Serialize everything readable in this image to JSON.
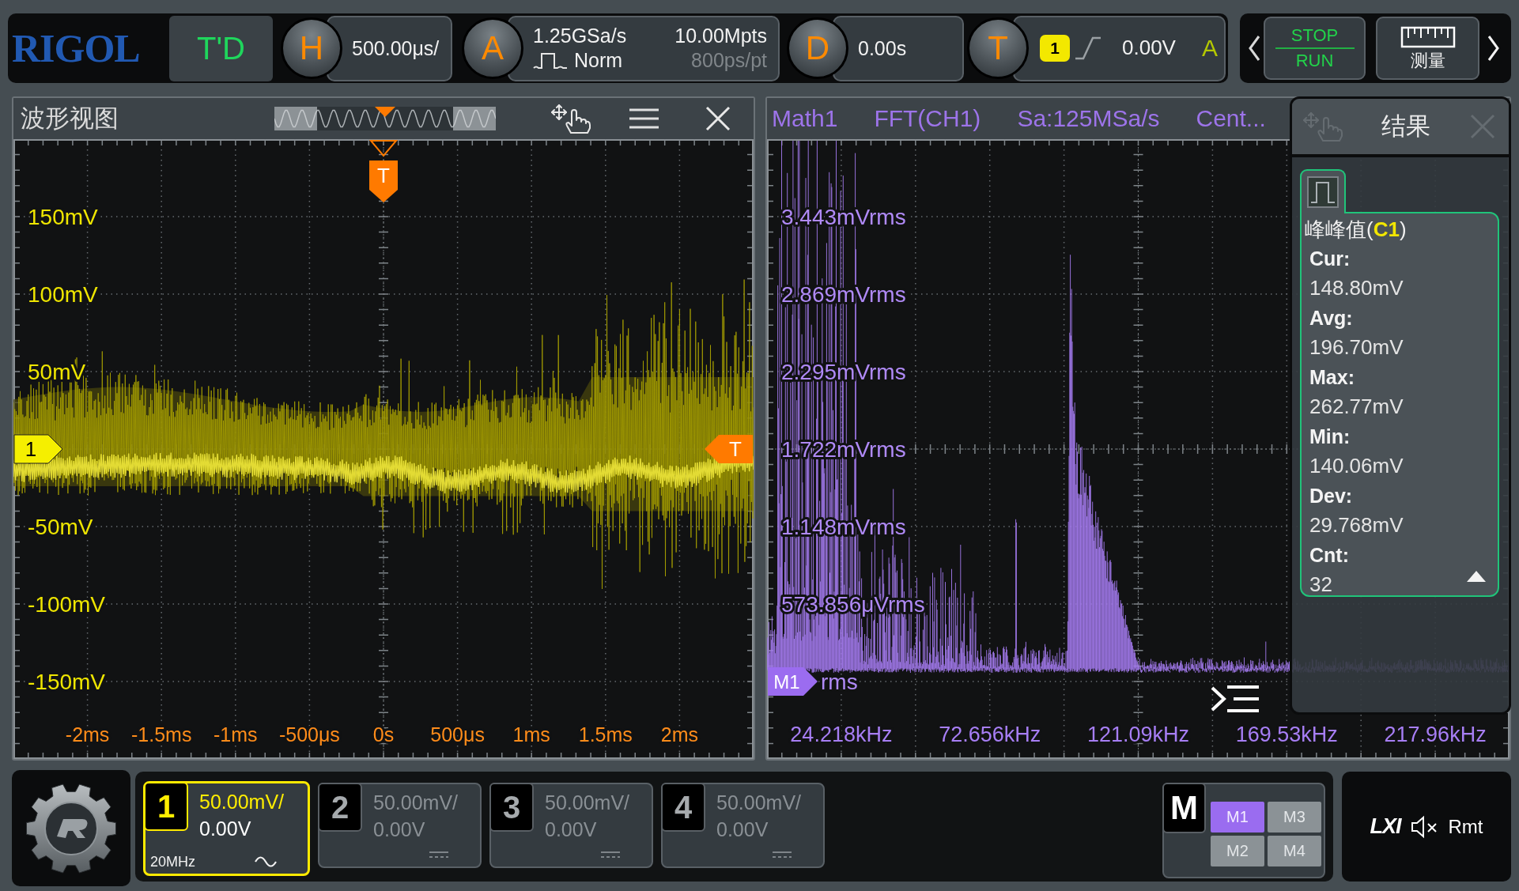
{
  "top_bar": {
    "logo": "RIGOL",
    "td_button": "T'D",
    "horizontal": {
      "badge": "H",
      "scale": "500.00μs/"
    },
    "acquisition": {
      "badge": "A",
      "sample_rate": "1.25GSa/s",
      "memory_depth": "10.00Mpts",
      "mode": "Norm",
      "time_per_point": "800ps/pt"
    },
    "delay": {
      "badge": "D",
      "offset": "0.00s"
    },
    "trigger": {
      "badge": "T",
      "source": "1",
      "level": "0.00V",
      "sweep": "A"
    },
    "run_stop": {
      "top": "STOP",
      "bottom": "RUN"
    },
    "measure_button": "测量"
  },
  "waveform_view": {
    "title": "波形视图",
    "y_labels": [
      "150mV",
      "100mV",
      "50mV",
      "-50mV",
      "-100mV",
      "-150mV"
    ],
    "x_labels": [
      "-2ms",
      "-1.5ms",
      "-1ms",
      "-500μs",
      "0s",
      "500μs",
      "1ms",
      "1.5ms",
      "2ms"
    ],
    "trigger_position_marker": "T",
    "channel_marker": "1",
    "trigger_level_marker": "T"
  },
  "fft_view": {
    "header": [
      "Math1",
      "FFT(CH1)",
      "Sa:125MSa/s",
      "Cent..."
    ],
    "y_labels": [
      "3.443mVrms",
      "2.869mVrms",
      "2.295mVrms",
      "1.722mVrms",
      "1.148mVrms",
      "573.856μVrms",
      "rms"
    ],
    "x_labels": [
      "24.218kHz",
      "72.656kHz",
      "121.09kHz",
      "169.53kHz",
      "217.96kHz"
    ],
    "math_marker": "M1"
  },
  "results": {
    "title": "结果",
    "measurement": {
      "title_parts": [
        {
          "text": "峰峰值(",
          "kind": "plain"
        },
        {
          "text": "C1",
          "kind": "source"
        },
        {
          "text": ")",
          "kind": "plain"
        }
      ],
      "rows": [
        {
          "label": "Cur:",
          "value": "148.80mV"
        },
        {
          "label": "Avg:",
          "value": "196.70mV"
        },
        {
          "label": "Max:",
          "value": "262.77mV"
        },
        {
          "label": "Min:",
          "value": "140.06mV"
        },
        {
          "label": "Dev:",
          "value": "29.768mV"
        },
        {
          "label": "Cnt:",
          "value": "32"
        }
      ]
    }
  },
  "channels": [
    {
      "number": "1",
      "scale": "50.00mV/",
      "offset": "0.00V",
      "bandwidth": "20MHz",
      "ac_coupled": true,
      "on": true
    },
    {
      "number": "2",
      "scale": "50.00mV/",
      "offset": "0.00V",
      "ac_coupled": false,
      "on": false
    },
    {
      "number": "3",
      "scale": "50.00mV/",
      "offset": "0.00V",
      "ac_coupled": false,
      "on": false
    },
    {
      "number": "4",
      "scale": "50.00mV/",
      "offset": "0.00V",
      "ac_coupled": false,
      "on": false
    }
  ],
  "math": {
    "badge": "M",
    "items": [
      {
        "label": "M1",
        "on": true
      },
      {
        "label": "M3",
        "on": false
      },
      {
        "label": "M2",
        "on": false
      },
      {
        "label": "M4",
        "on": false
      }
    ]
  },
  "status": {
    "lxi": "LXI",
    "muted": true,
    "remote": "Rmt"
  }
}
